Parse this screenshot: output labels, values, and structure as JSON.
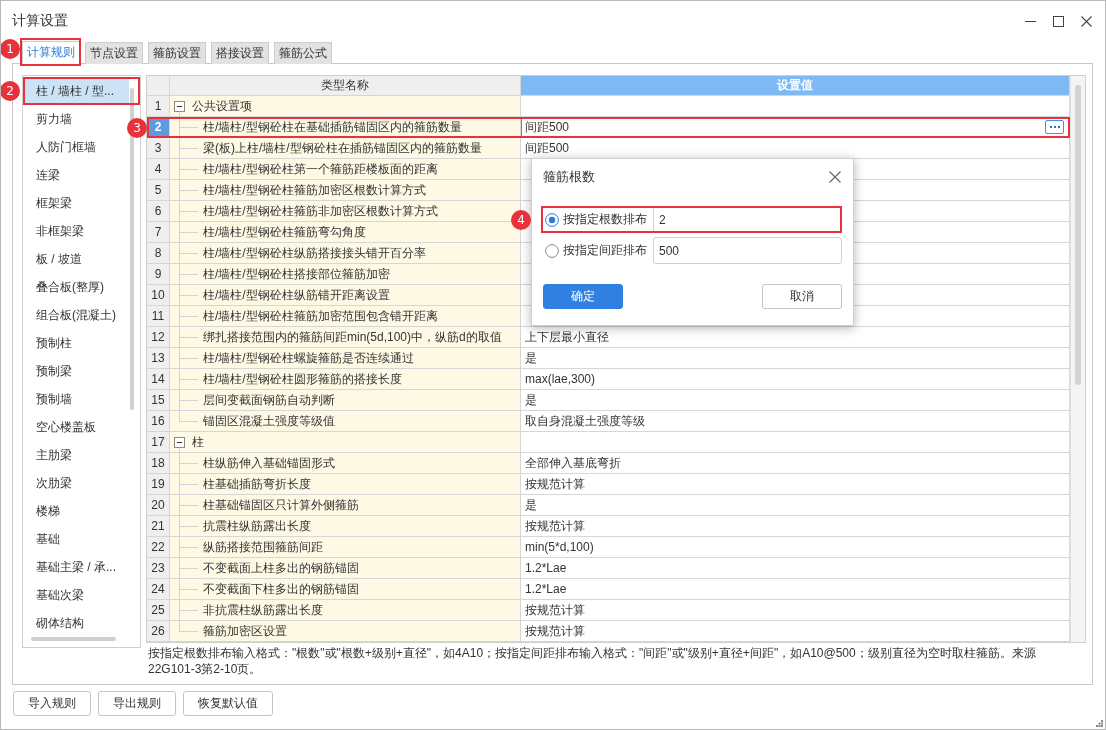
{
  "window": {
    "title": "计算设置"
  },
  "tabs": [
    {
      "label": "计算规则",
      "selected": true,
      "callout": "1"
    },
    {
      "label": "节点设置",
      "selected": false
    },
    {
      "label": "箍筋设置",
      "selected": false
    },
    {
      "label": "搭接设置",
      "selected": false
    },
    {
      "label": "箍筋公式",
      "selected": false
    }
  ],
  "sidebar": {
    "items": [
      {
        "label": "柱 / 墙柱 / 型...",
        "selected": true,
        "callout": "2"
      },
      {
        "label": "剪力墙",
        "selected": false
      },
      {
        "label": "人防门框墙",
        "selected": false
      },
      {
        "label": "连梁",
        "selected": false
      },
      {
        "label": "框架梁",
        "selected": false
      },
      {
        "label": "非框架梁",
        "selected": false
      },
      {
        "label": "板 / 坡道",
        "selected": false
      },
      {
        "label": "叠合板(整厚)",
        "selected": false
      },
      {
        "label": "组合板(混凝土)",
        "selected": false
      },
      {
        "label": "预制柱",
        "selected": false
      },
      {
        "label": "预制梁",
        "selected": false
      },
      {
        "label": "预制墙",
        "selected": false
      },
      {
        "label": "空心楼盖板",
        "selected": false
      },
      {
        "label": "主肋梁",
        "selected": false
      },
      {
        "label": "次肋梁",
        "selected": false
      },
      {
        "label": "楼梯",
        "selected": false
      },
      {
        "label": "基础",
        "selected": false
      },
      {
        "label": "基础主梁 / 承...",
        "selected": false
      },
      {
        "label": "基础次梁",
        "selected": false
      },
      {
        "label": "砌体结构",
        "selected": false
      }
    ]
  },
  "table": {
    "columns": [
      {
        "label": "类型名称",
        "selected": false
      },
      {
        "label": "设置值",
        "selected": true
      }
    ],
    "groups": [
      {
        "number": "1",
        "label": "公共设置项",
        "expanded": true,
        "selected": false,
        "children": [
          {
            "number": "2",
            "name": "柱/墙柱/型钢砼柱在基础插筋锚固区内的箍筋数量",
            "value": "间距500",
            "selected": true,
            "callout": "3"
          },
          {
            "number": "3",
            "name": "梁(板)上柱/墙柱/型钢砼柱在插筋锚固区内的箍筋数量",
            "value": "间距500",
            "selected": false
          },
          {
            "number": "4",
            "name": "柱/墙柱/型钢砼柱第一个箍筋距楼板面的距离",
            "selected": false
          },
          {
            "number": "5",
            "name": "柱/墙柱/型钢砼柱箍筋加密区根数计算方式",
            "selected": false
          },
          {
            "number": "6",
            "name": "柱/墙柱/型钢砼柱箍筋非加密区根数计算方式",
            "selected": false
          },
          {
            "number": "7",
            "name": "柱/墙柱/型钢砼柱箍筋弯勾角度",
            "selected": false
          },
          {
            "number": "8",
            "name": "柱/墙柱/型钢砼柱纵筋搭接接头错开百分率",
            "selected": false
          },
          {
            "number": "9",
            "name": "柱/墙柱/型钢砼柱搭接部位箍筋加密",
            "selected": false
          },
          {
            "number": "10",
            "name": "柱/墙柱/型钢砼柱纵筋错开距离设置",
            "selected": false
          },
          {
            "number": "11",
            "name": "柱/墙柱/型钢砼柱箍筋加密范围包含错开距离",
            "selected": false
          },
          {
            "number": "12",
            "name": "绑扎搭接范围内的箍筋间距min(5d,100)中，纵筋d的取值",
            "value": "上下层最小直径",
            "selected": false
          },
          {
            "number": "13",
            "name": "柱/墙柱/型钢砼柱螺旋箍筋是否连续通过",
            "value": "是",
            "selected": false
          },
          {
            "number": "14",
            "name": "柱/墙柱/型钢砼柱圆形箍筋的搭接长度",
            "value": "max(lae,300)",
            "selected": false
          },
          {
            "number": "15",
            "name": "层间变截面钢筋自动判断",
            "value": "是",
            "selected": false
          },
          {
            "number": "16",
            "name": "锚固区混凝土强度等级值",
            "value": "取自身混凝土强度等级",
            "selected": false
          }
        ]
      },
      {
        "number": "17",
        "label": "柱",
        "expanded": true,
        "selected": false,
        "children": [
          {
            "number": "18",
            "name": "柱纵筋伸入基础锚固形式",
            "value": "全部伸入基底弯折",
            "selected": false
          },
          {
            "number": "19",
            "name": "柱基础插筋弯折长度",
            "value": "按规范计算",
            "selected": false
          },
          {
            "number": "20",
            "name": "柱基础锚固区只计算外侧箍筋",
            "value": "是",
            "selected": false
          },
          {
            "number": "21",
            "name": "抗震柱纵筋露出长度",
            "value": "按规范计算",
            "selected": false
          },
          {
            "number": "22",
            "name": "纵筋搭接范围箍筋间距",
            "value": "min(5*d,100)",
            "selected": false
          },
          {
            "number": "23",
            "name": "不变截面上柱多出的钢筋锚固",
            "value": "1.2*Lae",
            "selected": false
          },
          {
            "number": "24",
            "name": "不变截面下柱多出的钢筋锚固",
            "value": "1.2*Lae",
            "selected": false
          },
          {
            "number": "25",
            "name": "非抗震柱纵筋露出长度",
            "value": "按规范计算",
            "selected": false
          },
          {
            "number": "26",
            "name": "箍筋加密区设置",
            "value": "按规范计算",
            "selected": false
          }
        ]
      }
    ]
  },
  "hint": "按指定根数排布输入格式：\"根数\"或\"根数+级别+直径\"，如4A10；按指定间距排布输入格式：\"间距\"或\"级别+直径+间距\"，如A10@500；级别直径为空时取柱箍筋。来源22G101-3第2-10页。",
  "buttons": [
    "导入规则",
    "导出规则",
    "恢复默认值"
  ],
  "dialog": {
    "title": "箍筋根数",
    "options": [
      {
        "label": "按指定根数排布",
        "selected": true,
        "value": "2",
        "callout": "4"
      },
      {
        "label": "按指定间距排布",
        "selected": false,
        "value": "500"
      }
    ],
    "buttons": [
      {
        "label": "确定",
        "kind": "primary"
      },
      {
        "label": "取消",
        "kind": "secondary"
      }
    ]
  }
}
